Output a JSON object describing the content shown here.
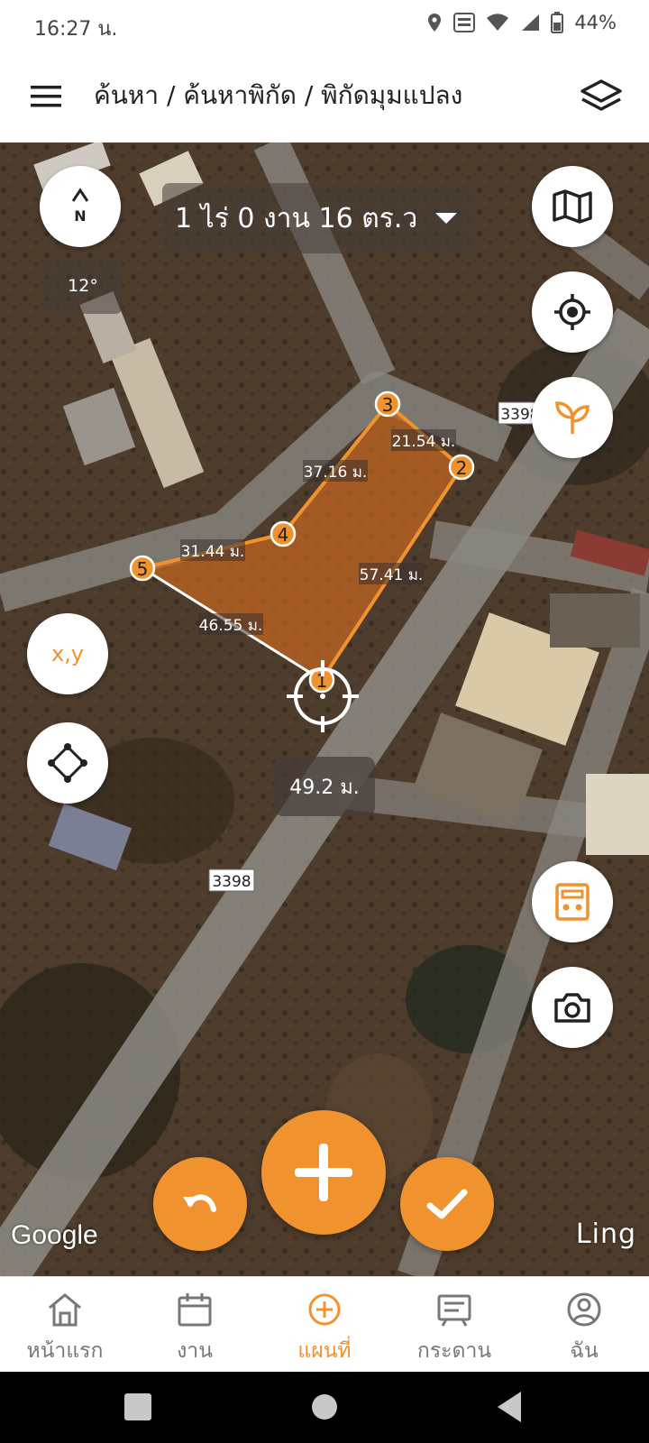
{
  "status": {
    "time": "16:27 น.",
    "battery": "44%"
  },
  "header": {
    "breadcrumb": "ค้นหา / ค้นหาพิกัด / พิกัดมุมแปลง"
  },
  "map": {
    "area": "1 ไร่ 0 งาน 16 ตร.ว",
    "compass_angle": "12°",
    "compass_letter": "N",
    "xy_label": "x,y",
    "current_distance": "49.2 ม.",
    "road_labels": [
      "3398",
      "3398"
    ],
    "points": [
      "1",
      "2",
      "3",
      "4",
      "5"
    ],
    "edges": [
      "21.54 ม.",
      "37.16 ม.",
      "31.44 ม.",
      "57.41 ม.",
      "46.55 ม."
    ],
    "google": "Google",
    "brand": "Ling"
  },
  "colors": {
    "accent": "#f0922e",
    "plot_fill": "#c8661f"
  },
  "nav": [
    {
      "label": "หน้าแรก",
      "icon": "home-icon"
    },
    {
      "label": "งาน",
      "icon": "calendar-icon"
    },
    {
      "label": "แผนที่",
      "icon": "add-circle-icon"
    },
    {
      "label": "กระดาน",
      "icon": "board-icon"
    },
    {
      "label": "ฉัน",
      "icon": "user-icon"
    }
  ]
}
